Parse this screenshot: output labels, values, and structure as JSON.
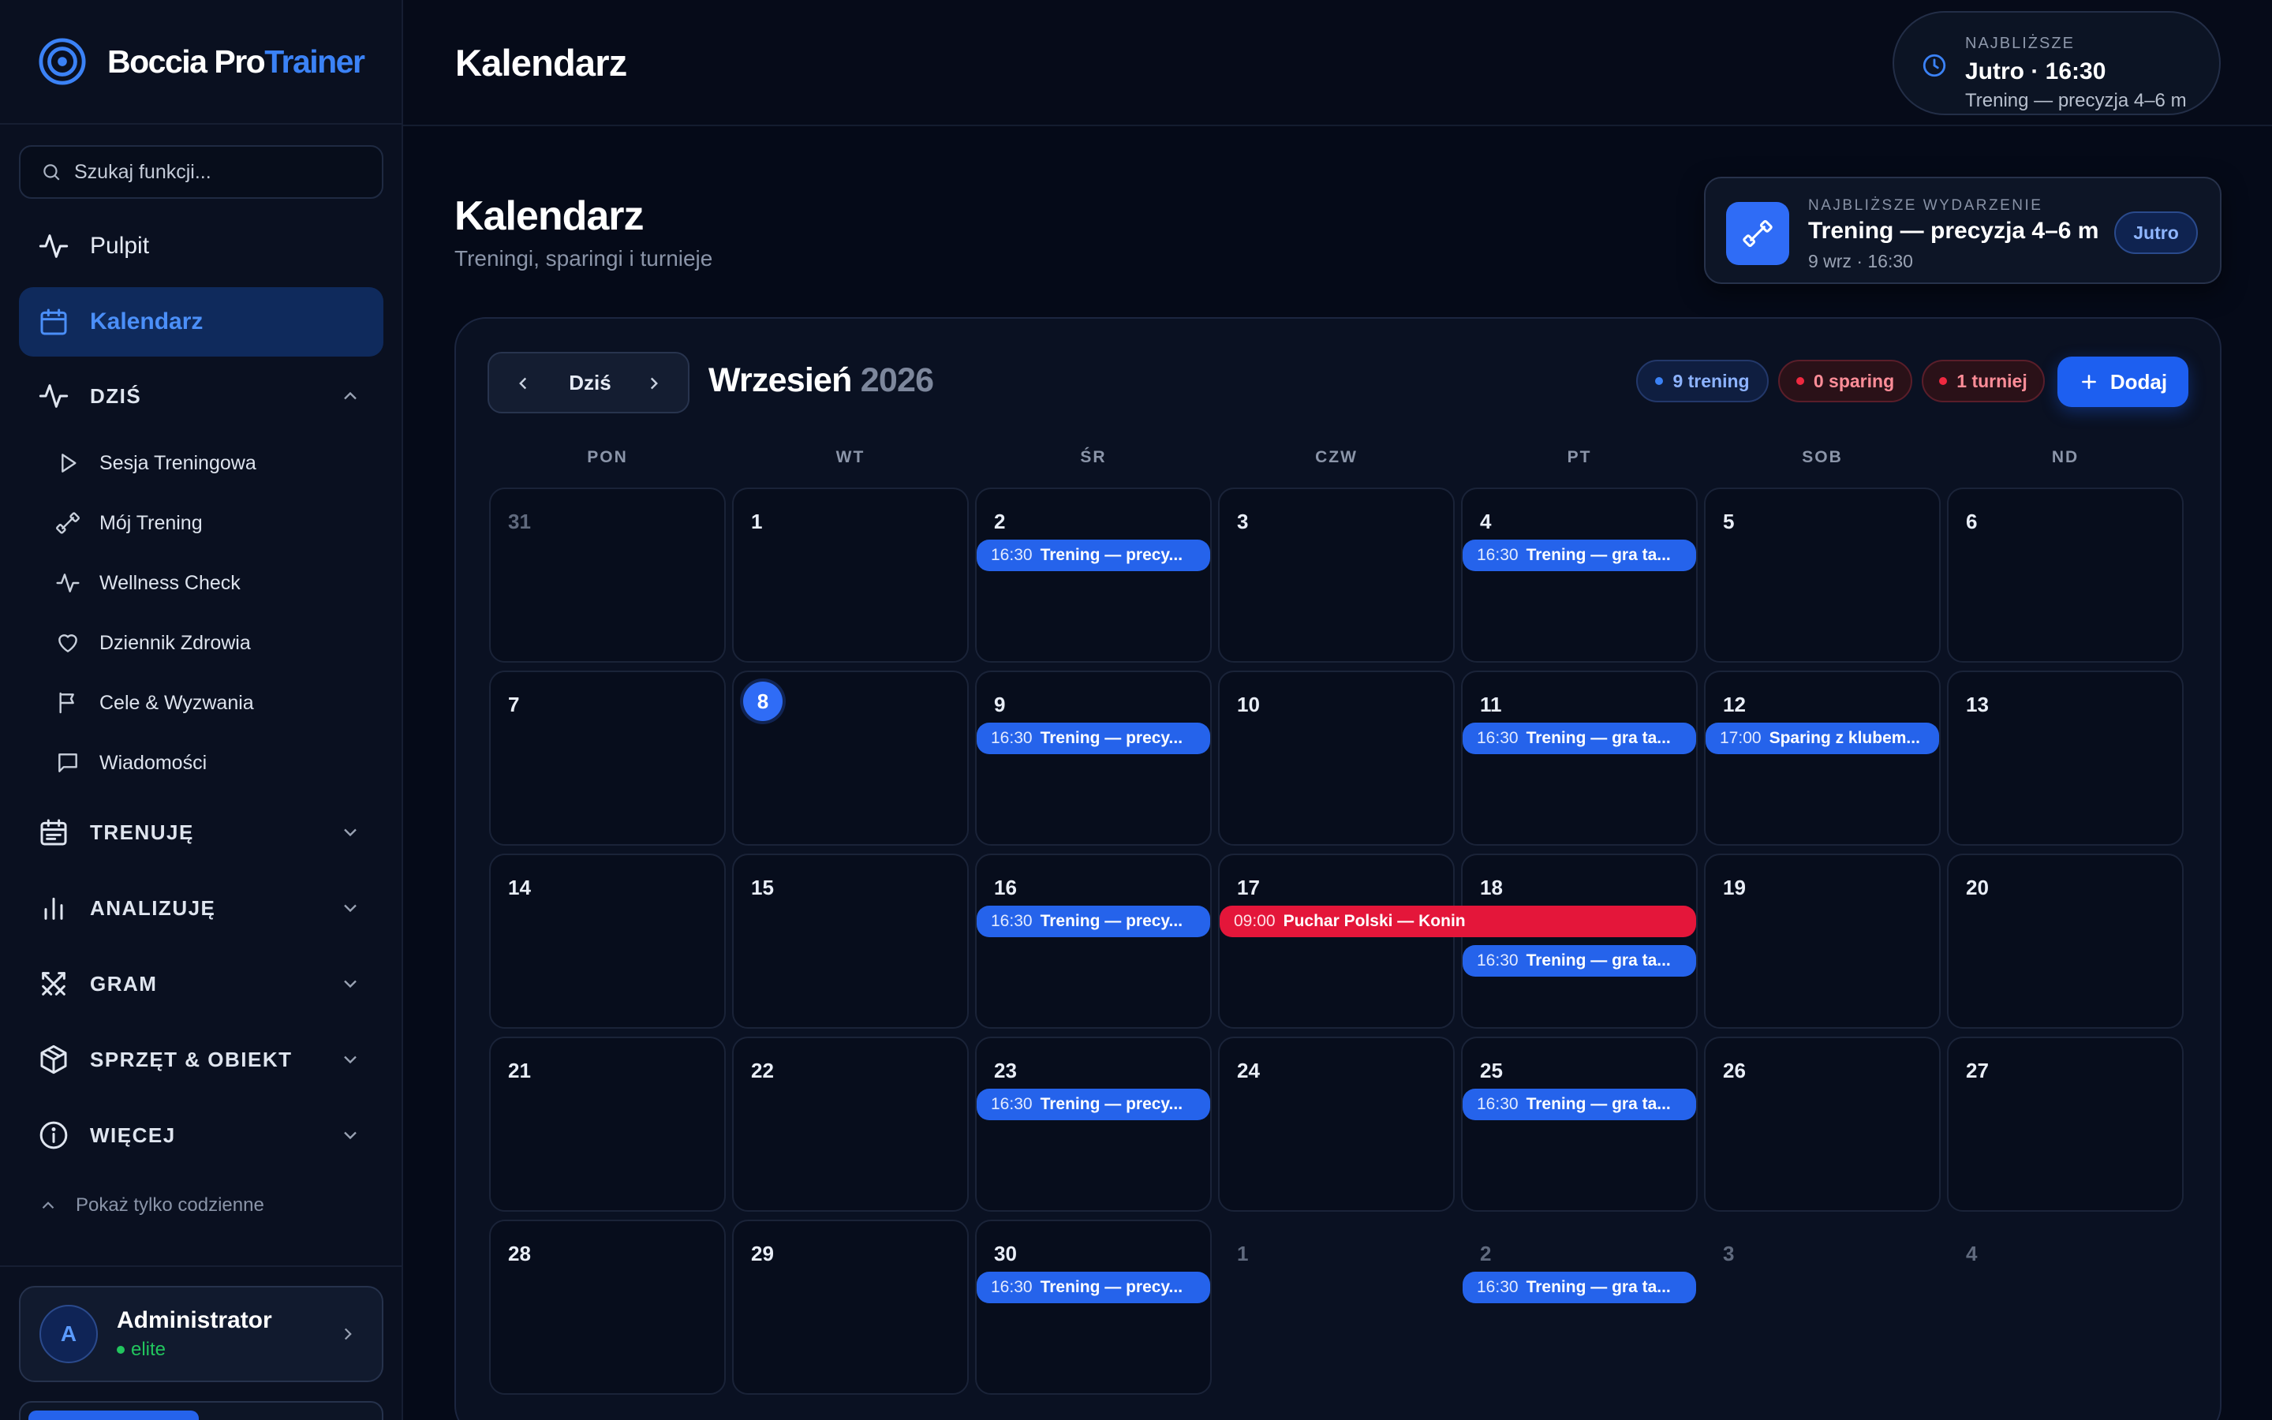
{
  "app": {
    "logo_part1": "Boccia Pro",
    "logo_part2": "Trainer"
  },
  "search": {
    "placeholder": "Szukaj funkcji..."
  },
  "sidebar": {
    "pulpit": "Pulpit",
    "kalendarz": "Kalendarz",
    "dzis": {
      "label": "DZIŚ",
      "items": [
        "Sesja Treningowa",
        "Mój Trening",
        "Wellness Check",
        "Dziennik Zdrowia",
        "Cele & Wyzwania",
        "Wiadomości"
      ]
    },
    "sections": [
      "TRENUJĘ",
      "ANALIZUJĘ",
      "GRAM",
      "SPRZĘT & OBIEKT",
      "WIĘCEJ"
    ],
    "show_daily": "Pokaż tylko codzienne",
    "user": {
      "initial": "A",
      "name": "Administrator",
      "role": "elite"
    }
  },
  "topbar": {
    "title": "Kalendarz",
    "next": {
      "label": "NAJBLIŻSZE",
      "main": "Jutro · 16:30",
      "sub": "Trening — precyzja 4–6 m"
    }
  },
  "page": {
    "title": "Kalendarz",
    "subtitle": "Treningi, sparingi i turnieje"
  },
  "next_event": {
    "label": "NAJBLIŻSZE WYDARZENIE",
    "title": "Trening — precyzja 4–6 m",
    "date": "9 wrz · 16:30",
    "tag": "Jutro"
  },
  "calendar": {
    "today_label": "Dziś",
    "month": "Wrzesień",
    "year": "2026",
    "chips": {
      "training": "9 trening",
      "sparing": "0 sparing",
      "tournament": "1 turniej"
    },
    "add_label": "Dodaj",
    "weekdays": [
      "PON",
      "WT",
      "ŚR",
      "CZW",
      "PT",
      "SOB",
      "ND"
    ],
    "days": [
      {
        "n": "31",
        "out": true
      },
      {
        "n": "1"
      },
      {
        "n": "2"
      },
      {
        "n": "3"
      },
      {
        "n": "4"
      },
      {
        "n": "5"
      },
      {
        "n": "6"
      },
      {
        "n": "7"
      },
      {
        "n": "8",
        "today": true
      },
      {
        "n": "9"
      },
      {
        "n": "10"
      },
      {
        "n": "11"
      },
      {
        "n": "12"
      },
      {
        "n": "13"
      },
      {
        "n": "14"
      },
      {
        "n": "15"
      },
      {
        "n": "16"
      },
      {
        "n": "17"
      },
      {
        "n": "18"
      },
      {
        "n": "19"
      },
      {
        "n": "20"
      },
      {
        "n": "21"
      },
      {
        "n": "22"
      },
      {
        "n": "23"
      },
      {
        "n": "24"
      },
      {
        "n": "25"
      },
      {
        "n": "26"
      },
      {
        "n": "27"
      },
      {
        "n": "28"
      },
      {
        "n": "29"
      },
      {
        "n": "30"
      },
      {
        "n": "1",
        "out": true
      },
      {
        "n": "2",
        "out": true
      },
      {
        "n": "3",
        "out": true
      },
      {
        "n": "4",
        "out": true
      }
    ],
    "events": [
      {
        "day": 2,
        "time": "16:30",
        "title": "Trening — precy..."
      },
      {
        "day": 4,
        "time": "16:30",
        "title": "Trening — gra ta..."
      },
      {
        "day": 9,
        "time": "16:30",
        "title": "Trening — precy..."
      },
      {
        "day": 11,
        "time": "16:30",
        "title": "Trening — gra ta..."
      },
      {
        "day": 12,
        "time": "17:00",
        "title": "Sparing z klubem..."
      },
      {
        "day": 16,
        "time": "16:30",
        "title": "Trening — precy..."
      },
      {
        "day": 17,
        "time": "09:00",
        "title": "Puchar Polski — Konin"
      },
      {
        "day": 18,
        "time": "16:30",
        "title": "Trening — gra ta..."
      },
      {
        "day": 23,
        "time": "16:30",
        "title": "Trening — precy..."
      },
      {
        "day": 25,
        "time": "16:30",
        "title": "Trening — gra ta..."
      },
      {
        "day": 30,
        "time": "16:30",
        "title": "Trening — precy..."
      },
      {
        "day": 2,
        "time": "16:30",
        "title": "Trening — gra ta...",
        "next_month": true
      }
    ]
  },
  "colors": {
    "accent": "#3b82f6",
    "training": "#2563eb",
    "tournament": "#e4163a",
    "background": "#050a18"
  }
}
